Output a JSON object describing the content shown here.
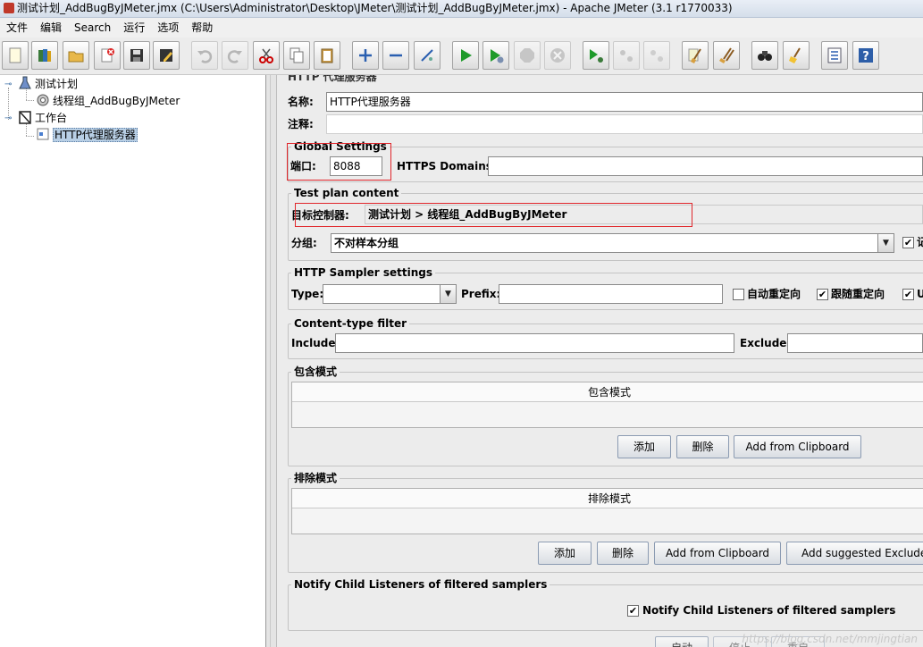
{
  "window": {
    "title": "测试计划_AddBugByJMeter.jmx (C:\\Users\\Administrator\\Desktop\\JMeter\\测试计划_AddBugByJMeter.jmx) - Apache JMeter (3.1 r1770033)"
  },
  "menu": [
    "文件",
    "编辑",
    "Search",
    "运行",
    "选项",
    "帮助"
  ],
  "tree": {
    "test_plan": "测试计划",
    "thread_group": "线程组_AddBugByJMeter",
    "workbench": "工作台",
    "proxy_server": "HTTP代理服务器"
  },
  "form": {
    "header_partial": "HTTP 代理服务器",
    "name_label": "名称:",
    "name_value": "HTTP代理服务器",
    "comment_label": "注释:",
    "comment_value": "",
    "global_settings": {
      "title": "Global Settings",
      "port_label": "端口:",
      "port_value": "8088",
      "https_label": "HTTPS Domains :",
      "https_value": ""
    },
    "test_plan_content": {
      "title": "Test plan content",
      "target_label": "目标控制器:",
      "target_value": "测试计划 > 线程组_AddBugByJMeter",
      "grouping_label": "分组:",
      "grouping_value": "不对样本分组",
      "record_check_label_partial": "记"
    },
    "sampler_settings": {
      "title": "HTTP Sampler settings",
      "type_label": "Type:",
      "type_value": "",
      "prefix_label": "Prefix:",
      "prefix_value": "",
      "auto_redirect_label": "自动重定向",
      "auto_redirect_checked": false,
      "follow_redirect_label": "跟随重定向",
      "follow_redirect_checked": true,
      "keepalive_partial_label": "U",
      "keepalive_checked": true
    },
    "content_filter": {
      "title": "Content-type filter",
      "include_label": "Include:",
      "include_value": "",
      "exclude_label": "Exclude:",
      "exclude_value": ""
    },
    "include_patterns": {
      "title": "包含模式",
      "column": "包含模式",
      "add": "添加",
      "delete": "删除",
      "clipboard": "Add from Clipboard"
    },
    "exclude_patterns": {
      "title": "排除模式",
      "column": "排除模式",
      "add": "添加",
      "delete": "删除",
      "clipboard": "Add from Clipboard",
      "suggested": "Add suggested Excludes"
    },
    "notify": {
      "title": "Notify Child Listeners of filtered samplers",
      "checkbox_label": "Notify Child Listeners of filtered samplers",
      "checked": true
    },
    "bottom_buttons": [
      "启动",
      "停止",
      "重启"
    ]
  },
  "checkmark": "✔",
  "watermark": "https://blog.csdn.net/mmjingtian",
  "colors": {
    "highlight_box": "#e0262b",
    "selection": "#b8cfe5"
  }
}
